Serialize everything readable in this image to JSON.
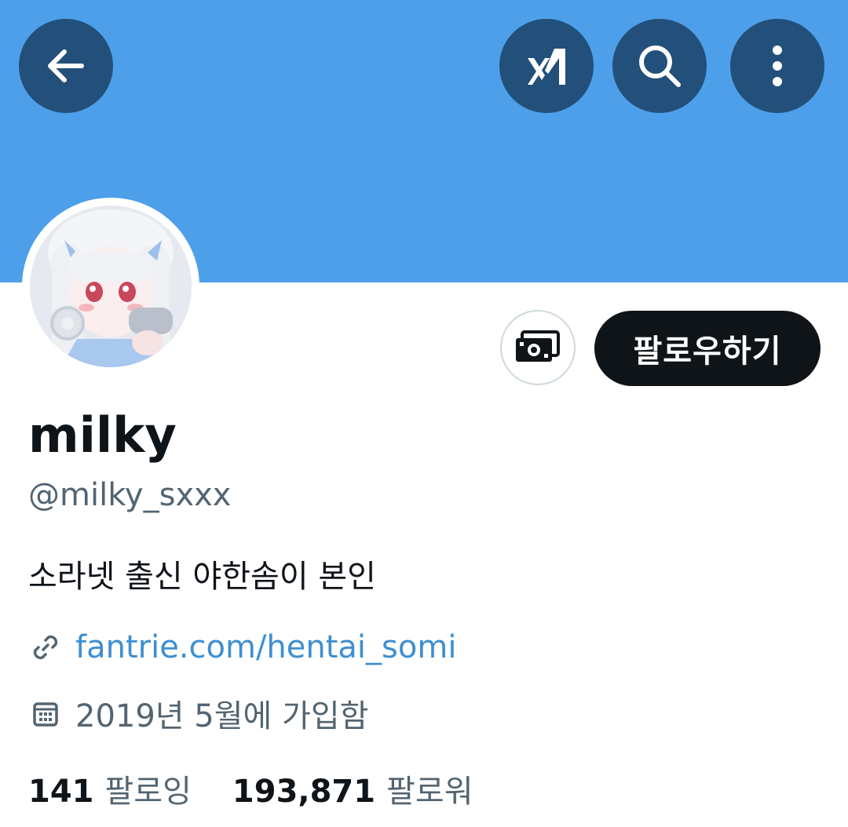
{
  "header": {
    "banner_color": "#4d9fea",
    "buttons": [
      {
        "name": "back",
        "icon": "arrow-left-icon"
      },
      {
        "name": "grok",
        "icon": "grok-icon"
      },
      {
        "name": "search",
        "icon": "search-icon"
      },
      {
        "name": "more",
        "icon": "more-vertical-icon"
      }
    ]
  },
  "profile": {
    "avatar_icon": "profile-avatar",
    "subscribe_icon": "money-icon",
    "follow_label": "팔로우하기",
    "display_name": "milky",
    "handle": "@milky_sxxx",
    "bio": "소라넷 출신 야한솜이 본인",
    "link": "fantrie.com/hentai_somi",
    "link_icon": "link-icon",
    "joined": "2019년 5월에 가입함",
    "joined_icon": "calendar-icon",
    "following_count": "141",
    "following_label": "팔로잉",
    "followers_count": "193,871",
    "followers_label": "팔로워"
  },
  "colors": {
    "accent_link": "#3d8fd1",
    "button_dark": "#0f1419",
    "overlay_button": "#22507a",
    "secondary_text": "#536471"
  }
}
